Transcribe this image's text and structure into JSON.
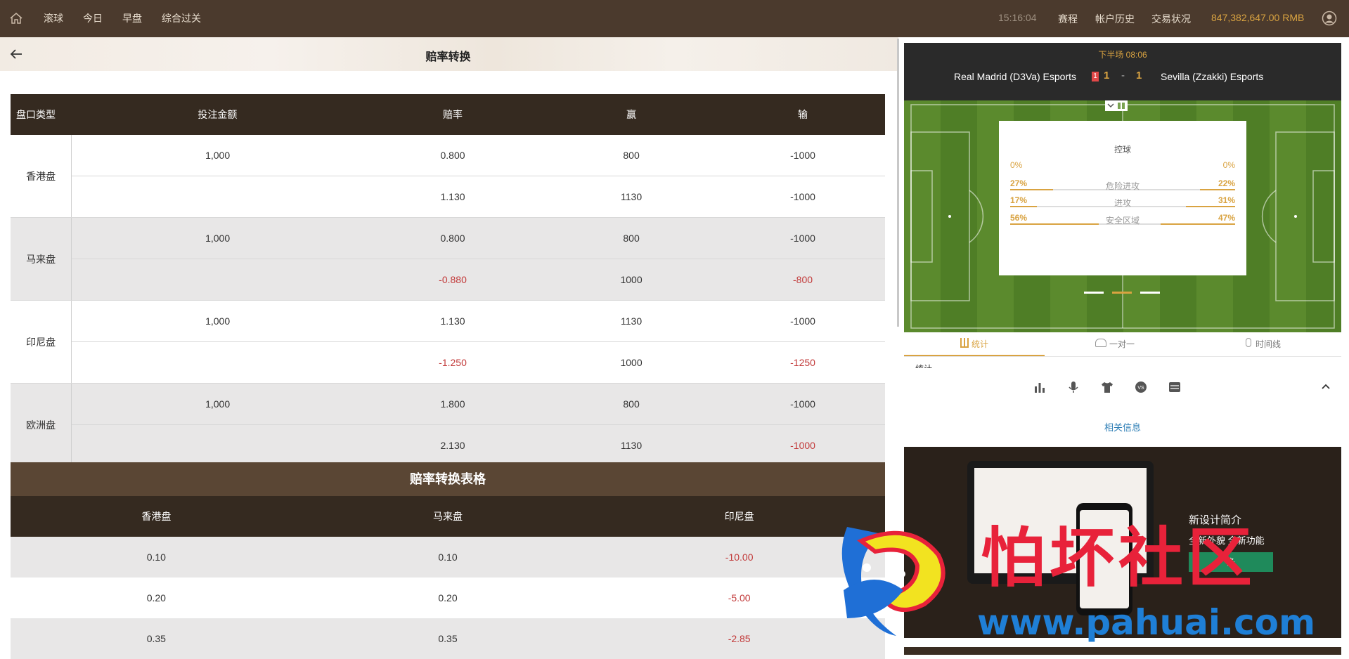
{
  "nav": {
    "items": [
      "滚球",
      "今日",
      "早盘",
      "综合过关"
    ],
    "time": "15:16:04",
    "links": [
      "赛程",
      "帐户历史",
      "交易状况"
    ],
    "balance": "847,382,647.00 RMB"
  },
  "page": {
    "title": "赔率转换"
  },
  "odds_table": {
    "headers": [
      "盘口类型",
      "投注金额",
      "赔率",
      "赢",
      "输"
    ],
    "groups": [
      {
        "label": "香港盘",
        "rows": [
          {
            "amount": "1,000",
            "odds": "0.800",
            "win": "800",
            "lose": "-1000"
          },
          {
            "amount": "",
            "odds": "1.130",
            "win": "1130",
            "lose": "-1000"
          }
        ]
      },
      {
        "label": "马来盘",
        "rows": [
          {
            "amount": "1,000",
            "odds": "0.800",
            "win": "800",
            "lose": "-1000"
          },
          {
            "amount": "",
            "odds": "-0.880",
            "win": "1000",
            "lose": "-800"
          }
        ]
      },
      {
        "label": "印尼盘",
        "rows": [
          {
            "amount": "1,000",
            "odds": "1.130",
            "win": "1130",
            "lose": "-1000"
          },
          {
            "amount": "",
            "odds": "-1.250",
            "win": "1000",
            "lose": "-1250"
          }
        ]
      },
      {
        "label": "欧洲盘",
        "rows": [
          {
            "amount": "1,000",
            "odds": "1.800",
            "win": "800",
            "lose": "-1000"
          },
          {
            "amount": "",
            "odds": "2.130",
            "win": "1130",
            "lose": "-1000"
          }
        ]
      }
    ]
  },
  "conversion": {
    "title": "赔率转换表格",
    "headers": [
      "香港盘",
      "马来盘",
      "印尼盘"
    ],
    "rows": [
      [
        "0.10",
        "0.10",
        "-10.00"
      ],
      [
        "0.20",
        "0.20",
        "-5.00"
      ],
      [
        "0.35",
        "0.35",
        "-2.85"
      ]
    ]
  },
  "match": {
    "status": "下半场 08:06",
    "home": "Real Madrid (D3Va) Esports",
    "away": "Sevilla (Zzakki) Esports",
    "red_cards_home": "1",
    "score_home": "1",
    "score_sep": "-",
    "score_away": "1",
    "stats": {
      "title": "控球",
      "possession_home": "0%",
      "possession_away": "0%",
      "items": [
        {
          "label": "危险进攻",
          "home": "27%",
          "away": "22%",
          "home_frac": 0.27,
          "away_frac": 0.22
        },
        {
          "label": "进攻",
          "home": "17%",
          "away": "31%",
          "home_frac": 0.17,
          "away_frac": 0.31
        },
        {
          "label": "安全区域",
          "home": "56%",
          "away": "47%",
          "home_frac": 0.56,
          "away_frac": 0.47
        }
      ]
    },
    "tabs": [
      "统计",
      "一对一",
      "时间线"
    ],
    "partial_label": "统计",
    "related": "相关信息"
  },
  "promo": {
    "title": "新设计简介",
    "subtitle": "全新外貌    全新功能",
    "button": "多"
  },
  "watermark": {
    "text": "怕坏社区",
    "url": "www.pahuai.com"
  },
  "colors": {
    "header": "#4b3a2d",
    "table_head": "#352a20",
    "accent": "#d9a341",
    "negative": "#c23a3a"
  }
}
